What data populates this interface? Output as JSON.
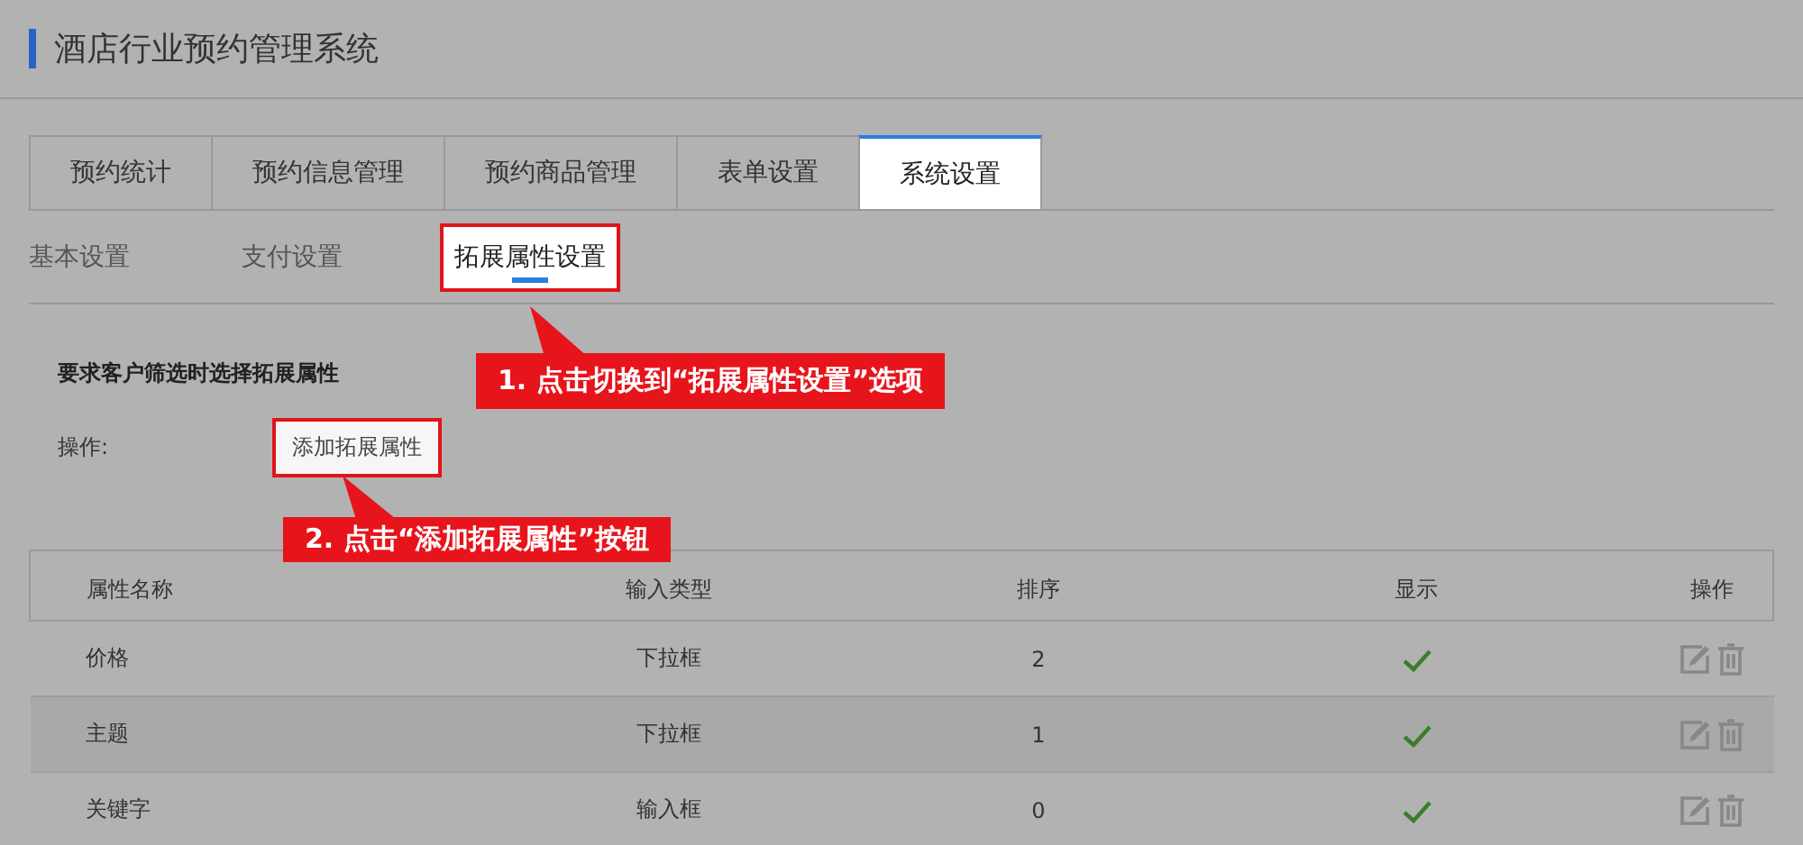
{
  "title": "酒店行业预约管理系统",
  "tabs": [
    {
      "label": "预约统计",
      "selected": false
    },
    {
      "label": "预约信息管理",
      "selected": false
    },
    {
      "label": "预约商品管理",
      "selected": false
    },
    {
      "label": "表单设置",
      "selected": false
    },
    {
      "label": "系统设置",
      "selected": true
    }
  ],
  "subtabs": [
    {
      "label": "基本设置",
      "selected": false
    },
    {
      "label": "支付设置",
      "selected": false
    },
    {
      "label": "拓展属性设置",
      "selected": true
    }
  ],
  "section_title": "要求客户筛选时选择拓展属性",
  "action_label": "操作:",
  "add_button": "添加拓展属性",
  "table": {
    "columns": [
      "属性名称",
      "输入类型",
      "排序",
      "显示",
      "操作"
    ],
    "rows": [
      {
        "name": "价格",
        "input_type": "下拉框",
        "order": "2",
        "shown": true
      },
      {
        "name": "主题",
        "input_type": "下拉框",
        "order": "1",
        "shown": true
      },
      {
        "name": "关键字",
        "input_type": "输入框",
        "order": "0",
        "shown": true
      }
    ]
  },
  "callouts": [
    {
      "text": "1. 点击切换到“拓展属性设置”选项"
    },
    {
      "text": "2. 点击“添加拓展属性”按钮"
    }
  ]
}
